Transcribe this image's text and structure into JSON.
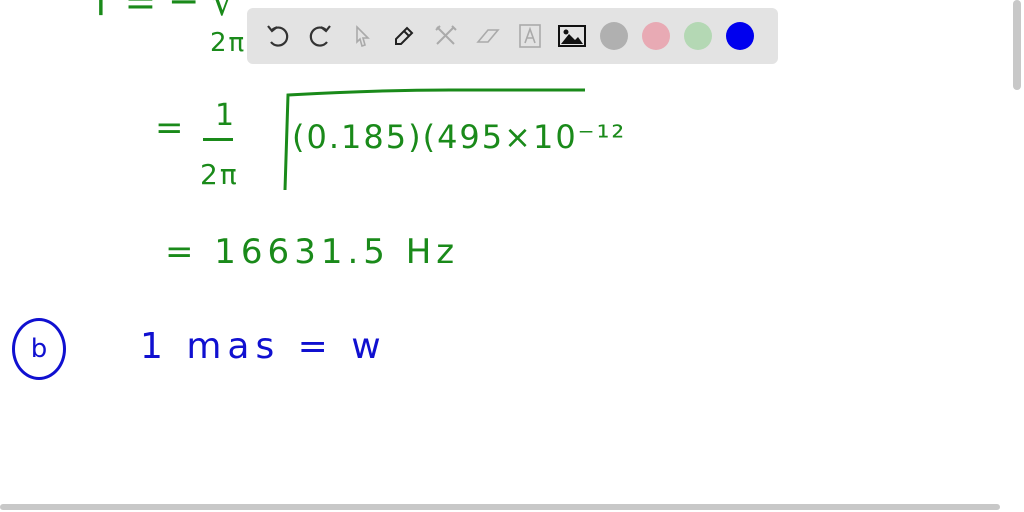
{
  "board": {
    "line1_partial": "f = ─ √",
    "line1_denominator": "2π",
    "line2_equals": "=",
    "line2_numerator": "1",
    "line2_denominator": "2π",
    "line2_radicand": "(0.185)(495×10⁻¹²",
    "line3": "= 16631.5 Hz",
    "part_label": "b",
    "line4": "1 mas = w"
  },
  "toolbar": {
    "tools": [
      "undo-icon",
      "redo-icon",
      "select-icon",
      "pen-icon",
      "tools-icon",
      "eraser-icon",
      "text-icon",
      "image-icon"
    ],
    "colors": [
      "#b0b0b0",
      "#e8aab4",
      "#b4d8b4",
      "#0000ee"
    ]
  }
}
